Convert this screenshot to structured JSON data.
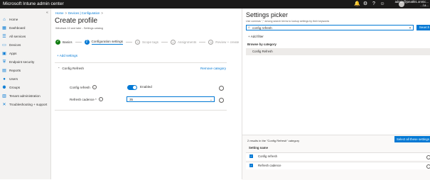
{
  "app": {
    "title": "Microsoft Intune admin center",
    "account_line1": "admin@jonatl01.onmic...",
    "account_line2": "...l.a..."
  },
  "sidebar": {
    "items": [
      {
        "label": "Home",
        "icon": "home-icon"
      },
      {
        "label": "Dashboard",
        "icon": "dashboard-icon"
      },
      {
        "label": "All services",
        "icon": "all-services-icon"
      },
      {
        "label": "Devices",
        "icon": "devices-icon"
      },
      {
        "label": "Apps",
        "icon": "apps-icon"
      },
      {
        "label": "Endpoint security",
        "icon": "shield-icon"
      },
      {
        "label": "Reports",
        "icon": "reports-icon"
      },
      {
        "label": "Users",
        "icon": "users-icon"
      },
      {
        "label": "Groups",
        "icon": "groups-icon"
      },
      {
        "label": "Tenant administration",
        "icon": "tenant-admin-icon"
      },
      {
        "label": "Troubleshooting + support",
        "icon": "wrench-icon"
      }
    ]
  },
  "main": {
    "breadcrumb": [
      "Home",
      "Devices | Configuration"
    ],
    "title": "Create profile",
    "subtitle": "Windows 10 and later - Settings catalog",
    "steps": [
      {
        "num": "✓",
        "label": "Basics",
        "state": "done"
      },
      {
        "num": "2",
        "label": "Configuration settings",
        "state": "current"
      },
      {
        "num": "3",
        "label": "Scope tags",
        "state": "future"
      },
      {
        "num": "4",
        "label": "Assignments",
        "state": "future"
      },
      {
        "num": "5",
        "label": "Review + create",
        "state": "future"
      }
    ],
    "add_settings": "+ Add settings",
    "group_name": "Config Refresh",
    "remove_category": "Remove category",
    "settings": {
      "refresh_label": "Config refresh",
      "refresh_state": "Enabled",
      "cadence_label": "Refresh cadence *",
      "cadence_value": "35"
    }
  },
  "picker": {
    "title": "Settings picker",
    "hint": "Use commas \",\" among search terms to lookup settings by their keywords",
    "search_value": "config refresh",
    "search_button": "Search",
    "add_filter": "+ Add filter",
    "browse_label": "Browse by category",
    "category": "Config Refresh",
    "results_text": "2 results in the \"Config Refresh\" category",
    "select_all": "Select all these settings",
    "column_header": "Setting name",
    "results": [
      {
        "label": "Config refresh"
      },
      {
        "label": "Refresh cadence"
      }
    ]
  }
}
